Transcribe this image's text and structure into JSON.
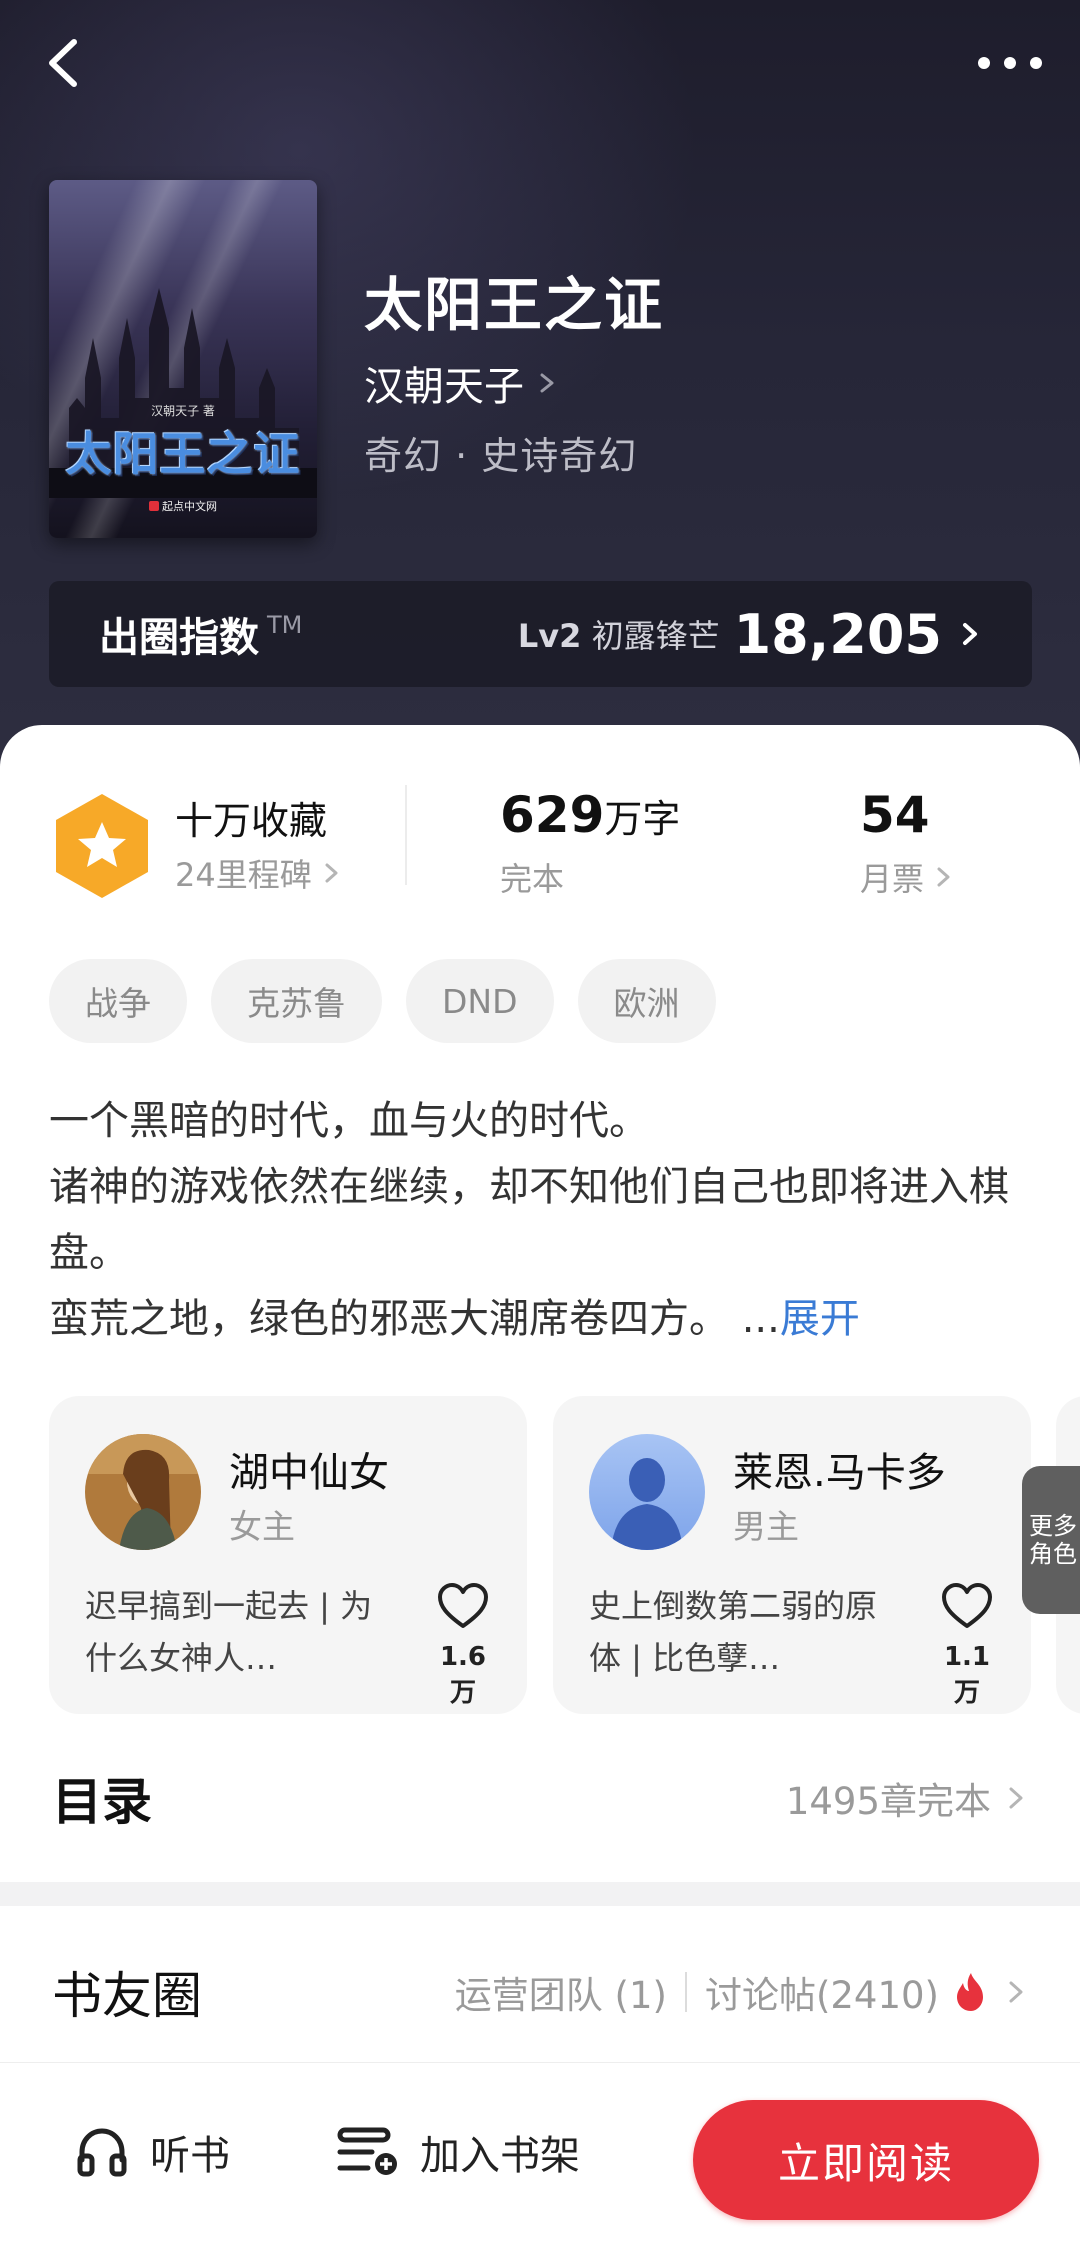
{
  "header": {
    "book_title": "太阳王之证",
    "author": "汉朝天子",
    "genre": "奇幻 · 史诗奇幻",
    "cover": {
      "author_line": "汉朝天子 著",
      "title": "太阳王之证",
      "publisher": "起点中文网"
    }
  },
  "index_bar": {
    "label": "出圈指数",
    "tm": "TM",
    "level_prefix": "Lv2",
    "level_name": "初露锋芒",
    "value": "18,205"
  },
  "stats": {
    "collection": {
      "title": "十万收藏",
      "sub": "24里程碑"
    },
    "words": {
      "number": "629",
      "unit": "万字",
      "sub": "完本"
    },
    "tickets": {
      "number": "54",
      "sub": "月票"
    }
  },
  "tags": [
    "战争",
    "克苏鲁",
    "DND",
    "欧洲"
  ],
  "description": {
    "lines": [
      "一个黑暗的时代，血与火的时代。",
      "诸神的游戏依然在继续，却不知他们自己也即将进入棋盘。",
      "蛮荒之地，绿色的邪恶大潮席卷四方。 ..."
    ],
    "expand_label": "展开"
  },
  "roles": [
    {
      "name": "湖中仙女",
      "type": "女主",
      "desc": "迟早搞到一起去 | 为什么女神人…",
      "likes": "1.6万"
    },
    {
      "name": "莱恩.马卡多",
      "type": "男主",
      "desc": "史上倒数第二弱的原体 | 比色孽…",
      "likes": "1.1万"
    }
  ],
  "more_roles_label": "更多角色",
  "catalog": {
    "title": "目录",
    "info": "1495章完本"
  },
  "circle": {
    "title": "书友圈",
    "team": "运营团队 (1)",
    "posts": "讨论帖(2410)"
  },
  "bottom": {
    "listen": "听书",
    "shelf": "加入书架",
    "read": "立即阅读"
  },
  "colors": {
    "accent_red": "#e7323d",
    "link_blue": "#3a7bd5",
    "badge_orange": "#f7a928"
  }
}
